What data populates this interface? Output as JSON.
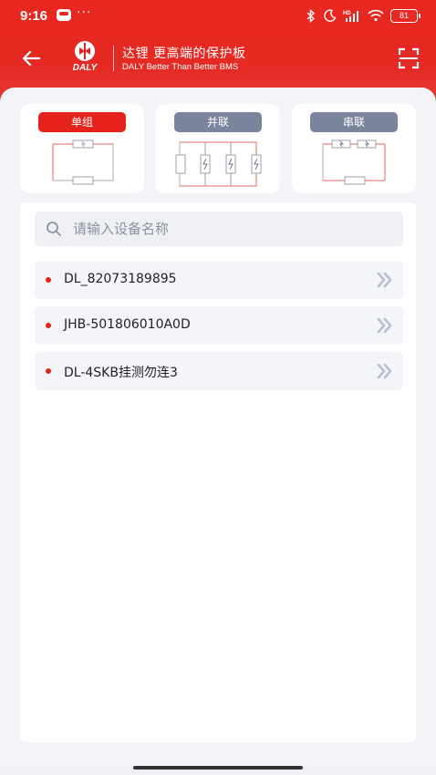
{
  "status_bar": {
    "time": "9:16",
    "dots": "···",
    "battery": "81",
    "icons": [
      "emoji-icon",
      "bluetooth-icon",
      "moon-icon",
      "hd-signal-icon",
      "wifi-icon",
      "battery-icon"
    ]
  },
  "header": {
    "brand": "DALY",
    "slogan_cn": "达锂 更高端的保护板",
    "slogan_en": "DALY Better Than Better BMS",
    "colors": {
      "brand_red": "#e5221b",
      "inactive_pill": "#7a849c"
    }
  },
  "modes": [
    {
      "label": "单组",
      "active": true
    },
    {
      "label": "并联",
      "active": false
    },
    {
      "label": "串联",
      "active": false
    }
  ],
  "search": {
    "placeholder": "请输入设备名称",
    "value": ""
  },
  "devices": [
    {
      "name": "DL_82073189895"
    },
    {
      "name": "JHB-501806010A0D"
    },
    {
      "name": "DL-4SKB挂测勿连3"
    }
  ]
}
